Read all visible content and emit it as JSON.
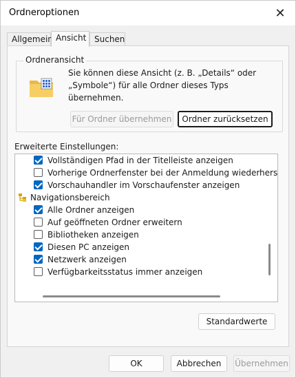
{
  "window": {
    "title": "Ordneroptionen",
    "close_glyph": "✕",
    "close_icon": "close-icon"
  },
  "tabs": [
    {
      "label": "Allgemein",
      "active": false
    },
    {
      "label": "Ansicht",
      "active": true
    },
    {
      "label": "Suchen",
      "active": false
    }
  ],
  "folder_view": {
    "title": "Ordneransicht",
    "description": "Sie können diese Ansicht (z. B. „Details“ oder „Symbole“) für alle Ordner dieses Typs übernehmen.",
    "apply_button": "Für Ordner übernehmen",
    "reset_button": "Ordner zurücksetzen",
    "icon": "folder-icon"
  },
  "advanced": {
    "label": "Erweiterte Einstellungen:",
    "items": [
      {
        "type": "checkbox",
        "label": "Vollständigen Pfad in der Titelleiste anzeigen",
        "checked": true
      },
      {
        "type": "checkbox",
        "label": "Vorherige Ordnerfenster bei der Anmeldung wiederherstellen",
        "checked": false
      },
      {
        "type": "checkbox",
        "label": "Vorschauhandler im Vorschaufenster anzeigen",
        "checked": true
      },
      {
        "type": "group",
        "label": "Navigationsbereich",
        "icon": "navigation-tree-icon"
      },
      {
        "type": "checkbox",
        "label": "Alle Ordner anzeigen",
        "checked": true
      },
      {
        "type": "checkbox",
        "label": "Auf geöffneten Ordner erweitern",
        "checked": false
      },
      {
        "type": "checkbox",
        "label": "Bibliotheken anzeigen",
        "checked": false
      },
      {
        "type": "checkbox",
        "label": "Diesen PC anzeigen",
        "checked": true
      },
      {
        "type": "checkbox",
        "label": "Netzwerk anzeigen",
        "checked": true
      },
      {
        "type": "checkbox",
        "label": "Verfügbarkeitsstatus immer anzeigen",
        "checked": false
      }
    ],
    "defaults_button": "Standardwerte"
  },
  "footer": {
    "ok": "OK",
    "cancel": "Abbrechen",
    "apply": "Übernehmen"
  },
  "colors": {
    "accent": "#0067c0",
    "nav_icon": "#d9a400"
  }
}
